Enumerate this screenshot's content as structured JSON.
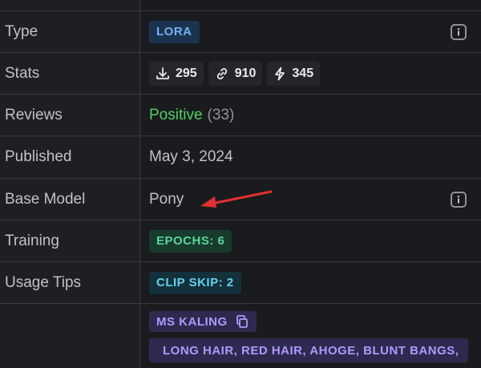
{
  "rows": {
    "type": {
      "label": "Type",
      "badge": "LORA"
    },
    "stats": {
      "label": "Stats",
      "downloads": "295",
      "links": "910",
      "buzz": "345"
    },
    "reviews": {
      "label": "Reviews",
      "sentiment": "Positive",
      "count": "(33)"
    },
    "published": {
      "label": "Published",
      "value": "May 3, 2024"
    },
    "base_model": {
      "label": "Base Model",
      "value": "Pony"
    },
    "training": {
      "label": "Training",
      "badge": "EPOCHS: 6"
    },
    "usage_tips": {
      "label": "Usage Tips",
      "badge": "CLIP SKIP: 2"
    },
    "trigger_words": {
      "words": [
        "MS KALING",
        "LONG HAIR, RED HAIR, AHOGE, BLUNT BANGS,"
      ]
    }
  },
  "icons": {
    "info": "info-icon",
    "download": "download-icon",
    "link": "link-icon",
    "bolt": "bolt-icon",
    "copy": "copy-icon",
    "arrow": "red-arrow-annotation"
  },
  "colors": {
    "background": "#1a1b1e",
    "positive": "#51cf66",
    "annotation_arrow": "#e03131"
  }
}
